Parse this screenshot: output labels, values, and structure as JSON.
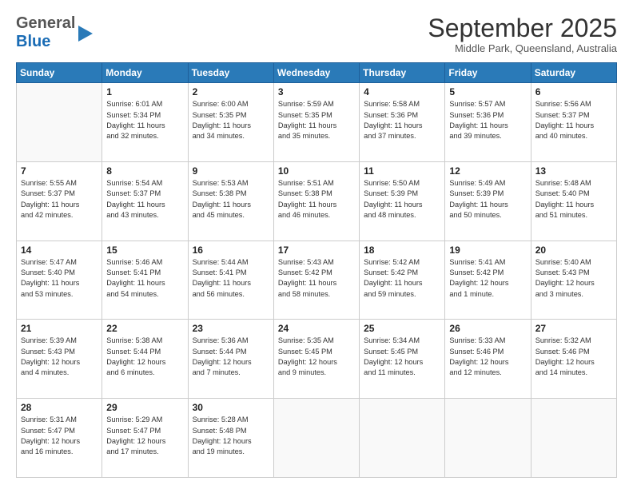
{
  "header": {
    "logo_general": "General",
    "logo_blue": "Blue",
    "month_title": "September 2025",
    "location": "Middle Park, Queensland, Australia"
  },
  "days_of_week": [
    "Sunday",
    "Monday",
    "Tuesday",
    "Wednesday",
    "Thursday",
    "Friday",
    "Saturday"
  ],
  "weeks": [
    [
      {
        "day": "",
        "info": ""
      },
      {
        "day": "1",
        "info": "Sunrise: 6:01 AM\nSunset: 5:34 PM\nDaylight: 11 hours\nand 32 minutes."
      },
      {
        "day": "2",
        "info": "Sunrise: 6:00 AM\nSunset: 5:35 PM\nDaylight: 11 hours\nand 34 minutes."
      },
      {
        "day": "3",
        "info": "Sunrise: 5:59 AM\nSunset: 5:35 PM\nDaylight: 11 hours\nand 35 minutes."
      },
      {
        "day": "4",
        "info": "Sunrise: 5:58 AM\nSunset: 5:36 PM\nDaylight: 11 hours\nand 37 minutes."
      },
      {
        "day": "5",
        "info": "Sunrise: 5:57 AM\nSunset: 5:36 PM\nDaylight: 11 hours\nand 39 minutes."
      },
      {
        "day": "6",
        "info": "Sunrise: 5:56 AM\nSunset: 5:37 PM\nDaylight: 11 hours\nand 40 minutes."
      }
    ],
    [
      {
        "day": "7",
        "info": "Sunrise: 5:55 AM\nSunset: 5:37 PM\nDaylight: 11 hours\nand 42 minutes."
      },
      {
        "day": "8",
        "info": "Sunrise: 5:54 AM\nSunset: 5:37 PM\nDaylight: 11 hours\nand 43 minutes."
      },
      {
        "day": "9",
        "info": "Sunrise: 5:53 AM\nSunset: 5:38 PM\nDaylight: 11 hours\nand 45 minutes."
      },
      {
        "day": "10",
        "info": "Sunrise: 5:51 AM\nSunset: 5:38 PM\nDaylight: 11 hours\nand 46 minutes."
      },
      {
        "day": "11",
        "info": "Sunrise: 5:50 AM\nSunset: 5:39 PM\nDaylight: 11 hours\nand 48 minutes."
      },
      {
        "day": "12",
        "info": "Sunrise: 5:49 AM\nSunset: 5:39 PM\nDaylight: 11 hours\nand 50 minutes."
      },
      {
        "day": "13",
        "info": "Sunrise: 5:48 AM\nSunset: 5:40 PM\nDaylight: 11 hours\nand 51 minutes."
      }
    ],
    [
      {
        "day": "14",
        "info": "Sunrise: 5:47 AM\nSunset: 5:40 PM\nDaylight: 11 hours\nand 53 minutes."
      },
      {
        "day": "15",
        "info": "Sunrise: 5:46 AM\nSunset: 5:41 PM\nDaylight: 11 hours\nand 54 minutes."
      },
      {
        "day": "16",
        "info": "Sunrise: 5:44 AM\nSunset: 5:41 PM\nDaylight: 11 hours\nand 56 minutes."
      },
      {
        "day": "17",
        "info": "Sunrise: 5:43 AM\nSunset: 5:42 PM\nDaylight: 11 hours\nand 58 minutes."
      },
      {
        "day": "18",
        "info": "Sunrise: 5:42 AM\nSunset: 5:42 PM\nDaylight: 11 hours\nand 59 minutes."
      },
      {
        "day": "19",
        "info": "Sunrise: 5:41 AM\nSunset: 5:42 PM\nDaylight: 12 hours\nand 1 minute."
      },
      {
        "day": "20",
        "info": "Sunrise: 5:40 AM\nSunset: 5:43 PM\nDaylight: 12 hours\nand 3 minutes."
      }
    ],
    [
      {
        "day": "21",
        "info": "Sunrise: 5:39 AM\nSunset: 5:43 PM\nDaylight: 12 hours\nand 4 minutes."
      },
      {
        "day": "22",
        "info": "Sunrise: 5:38 AM\nSunset: 5:44 PM\nDaylight: 12 hours\nand 6 minutes."
      },
      {
        "day": "23",
        "info": "Sunrise: 5:36 AM\nSunset: 5:44 PM\nDaylight: 12 hours\nand 7 minutes."
      },
      {
        "day": "24",
        "info": "Sunrise: 5:35 AM\nSunset: 5:45 PM\nDaylight: 12 hours\nand 9 minutes."
      },
      {
        "day": "25",
        "info": "Sunrise: 5:34 AM\nSunset: 5:45 PM\nDaylight: 12 hours\nand 11 minutes."
      },
      {
        "day": "26",
        "info": "Sunrise: 5:33 AM\nSunset: 5:46 PM\nDaylight: 12 hours\nand 12 minutes."
      },
      {
        "day": "27",
        "info": "Sunrise: 5:32 AM\nSunset: 5:46 PM\nDaylight: 12 hours\nand 14 minutes."
      }
    ],
    [
      {
        "day": "28",
        "info": "Sunrise: 5:31 AM\nSunset: 5:47 PM\nDaylight: 12 hours\nand 16 minutes."
      },
      {
        "day": "29",
        "info": "Sunrise: 5:29 AM\nSunset: 5:47 PM\nDaylight: 12 hours\nand 17 minutes."
      },
      {
        "day": "30",
        "info": "Sunrise: 5:28 AM\nSunset: 5:48 PM\nDaylight: 12 hours\nand 19 minutes."
      },
      {
        "day": "",
        "info": ""
      },
      {
        "day": "",
        "info": ""
      },
      {
        "day": "",
        "info": ""
      },
      {
        "day": "",
        "info": ""
      }
    ]
  ]
}
